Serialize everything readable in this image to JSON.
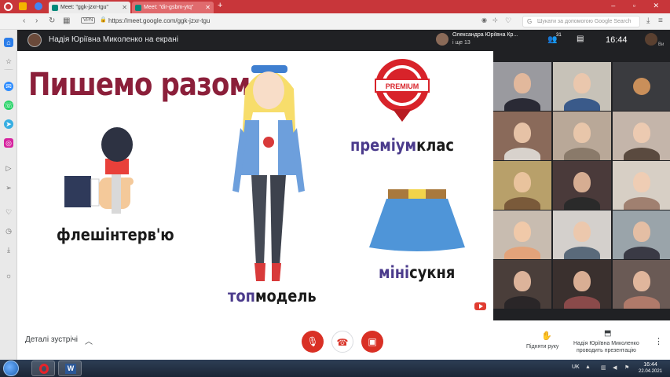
{
  "browser": {
    "tabs": [
      {
        "label": "Meet: \"ggk-jzxr-tgu\""
      },
      {
        "label": "Meet: \"dir-gsbm-ytq\""
      }
    ],
    "url": "https://meet.google.com/ggk-jzxr-tgu",
    "vpn_label": "VPN",
    "search_placeholder": "Шукати за допомогою Google Search",
    "new_tab": "+"
  },
  "meet_header": {
    "presenter_title": "Надія Юріївна Миколенко на екрані",
    "participant_name": "Олександра Юріївна Кр...",
    "participant_more": "і ще 13",
    "people_count": "31",
    "clock": "16:44",
    "self_label": "Ви"
  },
  "slide": {
    "title": "Пишемо разом",
    "premium_badge": "PREMIUM",
    "labels": {
      "interview": "флешінтерв'ю",
      "model_hl": "топ",
      "model_rest": "модель",
      "premium_hl": "преміум",
      "premium_rest": "клас",
      "mini_hl": "міні",
      "mini_rest": "сукня"
    }
  },
  "controls": {
    "details": "Деталі зустрічі",
    "raise_hand": "Підняти руку",
    "presenter_line1": "Надія Юріївна Миколенко",
    "presenter_line2": "проводить презентацію"
  },
  "taskbar": {
    "lang": "UK",
    "time": "16:44",
    "date": "22.04.2021"
  },
  "colors": {
    "accent_red": "#d93025",
    "title_color": "#8b1f3a",
    "highlight": "#4b3b8c"
  }
}
